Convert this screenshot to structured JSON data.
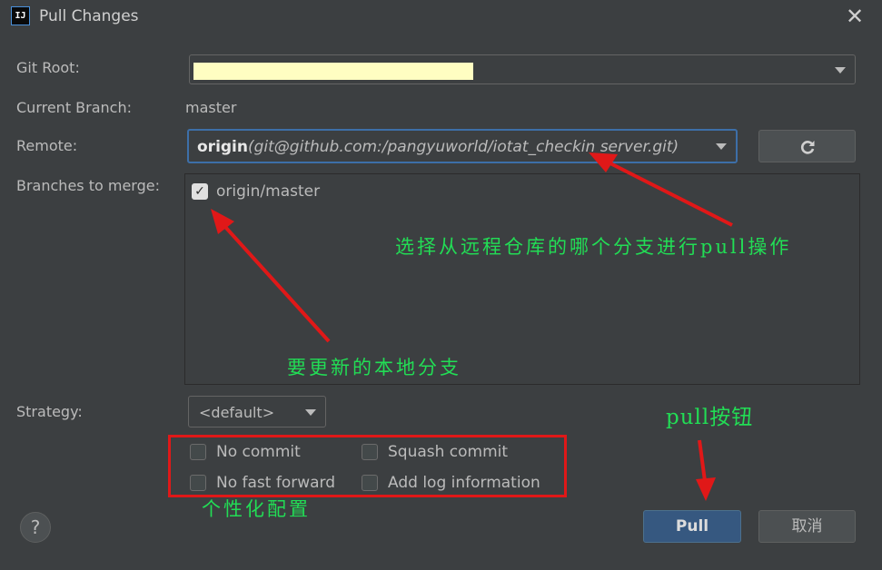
{
  "window": {
    "app_icon_text": "IJ",
    "title": "Pull Changes",
    "close_glyph": "✕"
  },
  "form": {
    "git_root_label": "Git Root:",
    "current_branch_label": "Current Branch:",
    "current_branch_value": "master",
    "remote_label": "Remote:",
    "remote_name": "origin",
    "remote_url": "(git@github.com:/pangyuworld/iotat_checkin server.git)",
    "branches_label": "Branches to merge:",
    "branch_item": "origin/master",
    "branch_checked": true,
    "strategy_label": "Strategy:",
    "strategy_value": "<default>"
  },
  "options": {
    "no_commit": "No commit",
    "squash_commit": "Squash commit",
    "no_fast_forward": "No fast forward",
    "add_log_information": "Add log information"
  },
  "buttons": {
    "help": "?",
    "pull": "Pull",
    "cancel": "取消"
  },
  "annotations": {
    "remote_note": "选择从远程仓库的哪个分支进行pull操作",
    "branch_note": "要更新的本地分支",
    "pull_note": "pull按钮",
    "options_note": "个性化配置"
  },
  "colors": {
    "background": "#3c3f41",
    "annotation": "#22dd55",
    "arrow": "#e01818",
    "pull_button": "#365880",
    "git_root_highlight": "#fffec2"
  },
  "icons": {
    "refresh": "refresh-icon",
    "close": "close-icon",
    "dropdown": "chevron-down-icon"
  }
}
